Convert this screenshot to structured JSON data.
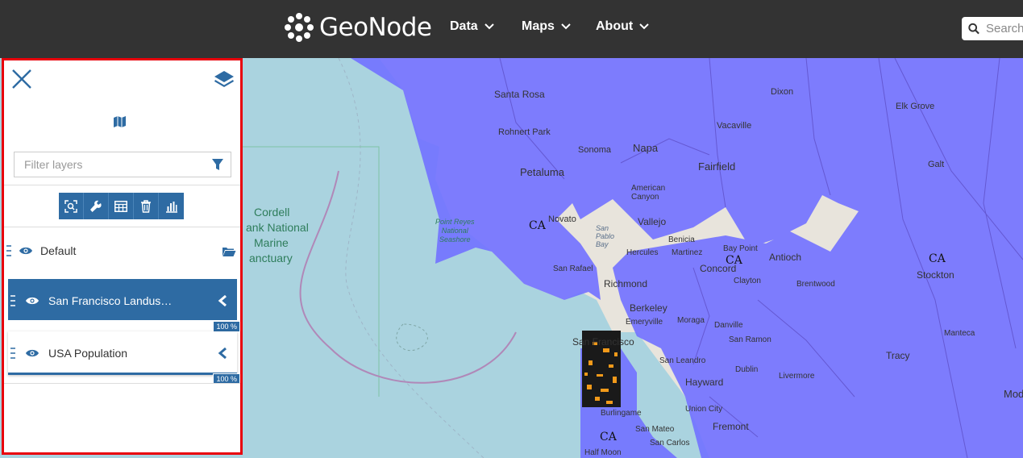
{
  "header": {
    "brand": "GeoNode",
    "nav": [
      {
        "label": "Data"
      },
      {
        "label": "Maps"
      },
      {
        "label": "About"
      }
    ],
    "search": {
      "placeholder": "Search"
    }
  },
  "toc": {
    "filter": {
      "placeholder": "Filter layers"
    },
    "group": {
      "label": "Default"
    },
    "layers": [
      {
        "label": "San Francisco Landus…",
        "opacity": "100 %",
        "selected": true
      },
      {
        "label": "USA Population",
        "opacity": "100 %",
        "selected": false
      }
    ]
  },
  "map": {
    "labels": {
      "ca_1": "CA",
      "ca_2": "CA",
      "ca_3": "CA",
      "ca_4": "CA",
      "santa_rosa": "Santa Rosa",
      "dixon": "Dixon",
      "elk_grove": "Elk Grove",
      "rohnert_park": "Rohnert Park",
      "vacaville": "Vacaville",
      "sonoma": "Sonoma",
      "napa": "Napa",
      "galt": "Galt",
      "petaluma": "Petaluma",
      "fairfield": "Fairfield",
      "american_canyon": "American Canyon",
      "vallejo": "Vallejo",
      "novato": "Novato",
      "san_pablo_bay": "San Pablo Bay",
      "benicia": "Benicia",
      "bay_point": "Bay Point",
      "antioch": "Antioch",
      "hercules": "Hercules",
      "martinez": "Martinez",
      "san_rafael": "San Rafael",
      "concord": "Concord",
      "stockton": "Stockton",
      "richmond": "Richmond",
      "clayton": "Clayton",
      "brentwood": "Brentwood",
      "berkeley": "Berkeley",
      "emeryville": "Emeryville",
      "moraga": "Moraga",
      "manteca": "Manteca",
      "danville": "Danville",
      "san_francisco": "San Francisco",
      "san_ramon": "San Ramon",
      "tracy": "Tracy",
      "san_leandro": "San Leandro",
      "dublin": "Dublin",
      "livermore": "Livermore",
      "hayward": "Hayward",
      "modesto": "Mod",
      "burlingame": "Burlingame",
      "union_city": "Union City",
      "fremont": "Fremont",
      "san_mateo": "San Mateo",
      "san_carlos": "San Carlos",
      "half_moon": "Half Moon",
      "cordell_1": "Cordell",
      "cordell_2": "ank National",
      "cordell_3": "Marine",
      "cordell_4": "anctuary",
      "point_reyes_1": "Point Reyes",
      "point_reyes_2": "National",
      "point_reyes_3": "Seashore"
    }
  }
}
